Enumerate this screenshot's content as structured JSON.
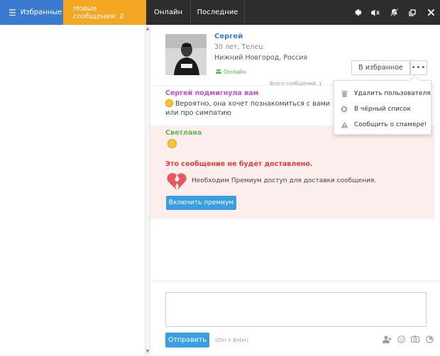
{
  "topbar": {
    "tabs": {
      "favorites": {
        "label": "Избранные",
        "icon": "menu-icon",
        "color": "#3a7bd0"
      },
      "new_messages": {
        "label": "Новые сообщения: 2",
        "color": "#f5a623"
      },
      "online": {
        "label": "Онлайн"
      },
      "recent": {
        "label": "Последние"
      }
    },
    "icons": [
      "gear-icon",
      "mute-icon",
      "notifications-off-icon",
      "popout-icon",
      "close-icon"
    ]
  },
  "profile": {
    "name": "Сергей",
    "age_sign": "30 лет, Телец",
    "city": "Нижний Новгород, Россия",
    "status": "Онлайн",
    "favorite_button": "В избранное",
    "more_button": "•••",
    "total_messages": "Всего сообщений: 1"
  },
  "menu": {
    "items": [
      {
        "label": "Удалить пользователя",
        "icon": "trash-icon"
      },
      {
        "label": "В чёрный список",
        "icon": "block-icon"
      },
      {
        "label": "Сообщить о спамере!",
        "icon": "warning-icon"
      }
    ]
  },
  "messages": {
    "wink": {
      "title": "Сергей подмигнула вам",
      "text": "Вероятно, она хочет познакомиться с вами или про симпатию"
    },
    "sent": {
      "author": "Светлана",
      "warning": "Это сообщение не будет доставлено.",
      "notice": "Необходим Премиум доступ для доставки сообщения.",
      "premium_button": "Включить премиум"
    }
  },
  "composer": {
    "input_value": "",
    "send_button": "Отправить",
    "hint": "(Ctrl + Enter)",
    "icons": [
      "add-user-icon",
      "emoji-icon",
      "camera-icon",
      "sticker-icon"
    ]
  },
  "colors": {
    "accent_blue": "#3a7bd0",
    "button_blue": "#3a9ee4",
    "orange": "#f5a623",
    "warning_red": "#e23c3c",
    "online_green": "#5ab65a",
    "wink_title": "#c24fcf",
    "pink_bg": "#fdeded"
  }
}
